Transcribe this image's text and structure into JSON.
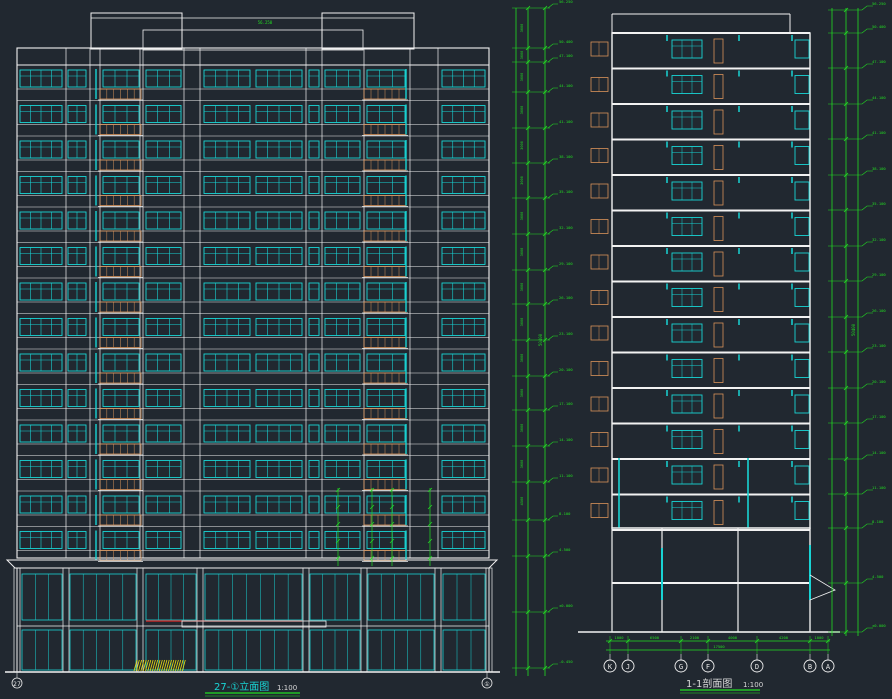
{
  "drawing": {
    "background": "#212830",
    "palette": {
      "outline": "#f2f2f2",
      "window": "#19d4d4",
      "balcony": "#d9935a",
      "dimension": "#22dd22",
      "axis_text": "#e8e8e8",
      "hatch": "#e8e010",
      "red_line": "#e02424",
      "label": "#d8d8d8"
    }
  },
  "elevation": {
    "title": "27-①立面图",
    "scale": "1:100",
    "floors": 14,
    "axis_left": "27",
    "axis_right": "①",
    "roof_level": "56.250"
  },
  "section": {
    "title": "1-1剖面图",
    "scale": "1:100",
    "floors": 14,
    "axes": [
      "K",
      "J",
      "G",
      "F",
      "D",
      "B",
      "A"
    ],
    "bottom_dims": [
      "1000",
      "6500",
      "2100",
      "4000",
      "4200",
      "1000"
    ],
    "total_dim": "17500"
  },
  "level_marks": [
    "56.250",
    "50.400",
    "47.100",
    "44.100",
    "41.100",
    "38.100",
    "35.100",
    "32.100",
    "29.100",
    "26.100",
    "23.100",
    "20.100",
    "17.100",
    "14.100",
    "11.100",
    "8.100",
    "4.500",
    "±0.000",
    "-0.450"
  ],
  "story_heights": [
    "3000",
    "3000",
    "3000",
    "3000",
    "3000",
    "3000",
    "3000",
    "3000",
    "3000",
    "3000",
    "3000",
    "3000",
    "3000",
    "3600",
    "4500"
  ],
  "total_height": "50400"
}
